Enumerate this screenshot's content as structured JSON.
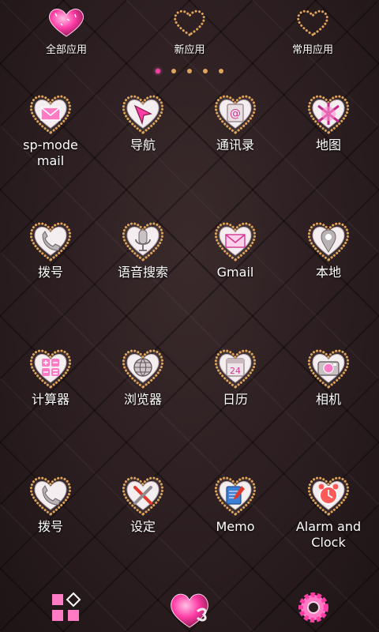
{
  "top_tabs": [
    {
      "label": "全部应用",
      "icon": "glitter-heart-icon"
    },
    {
      "label": "新应用",
      "icon": "dotted-heart-icon"
    },
    {
      "label": "常用应用",
      "icon": "dotted-heart-icon"
    }
  ],
  "page_indicator": {
    "total": 5,
    "active": 1
  },
  "apps": [
    {
      "label": "sp-mode\nmail",
      "icon": "mail-envelope-icon"
    },
    {
      "label": "导航",
      "icon": "navigation-arrow-icon"
    },
    {
      "label": "通讯录",
      "icon": "contacts-book-icon"
    },
    {
      "label": "地图",
      "icon": "map-icon"
    },
    {
      "label": "拨号",
      "icon": "phone-handset-icon"
    },
    {
      "label": "语音搜索",
      "icon": "microphone-icon"
    },
    {
      "label": "Gmail",
      "icon": "gmail-envelope-icon"
    },
    {
      "label": "本地",
      "icon": "location-pin-icon"
    },
    {
      "label": "计算器",
      "icon": "calculator-icon"
    },
    {
      "label": "浏览器",
      "icon": "globe-icon"
    },
    {
      "label": "日历",
      "icon": "calendar-icon"
    },
    {
      "label": "相机",
      "icon": "camera-icon"
    },
    {
      "label": "拨号",
      "icon": "phone-handset-icon"
    },
    {
      "label": "设定",
      "icon": "tools-icon"
    },
    {
      "label": "Memo",
      "icon": "notebook-pen-icon"
    },
    {
      "label": "Alarm and\nClock",
      "icon": "alarm-clock-icon"
    }
  ],
  "calendar_day": "24",
  "dock": [
    {
      "icon": "app-grid-icon"
    },
    {
      "icon": "gift-heart-icon"
    },
    {
      "icon": "settings-gear-icon"
    }
  ],
  "colors": {
    "accent_pink": "#ff3da6",
    "bead_gold": "#e0a45a",
    "heart_white": "#f4eef0"
  }
}
